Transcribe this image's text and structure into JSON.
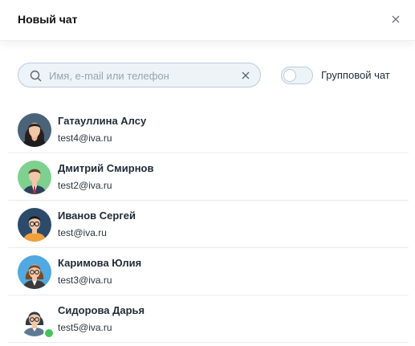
{
  "header": {
    "title": "Новый чат",
    "close_icon": "close-icon"
  },
  "search": {
    "placeholder": "Имя, e-mail или телефон",
    "value": ""
  },
  "group_toggle": {
    "label": "Групповой чат",
    "on": false
  },
  "contacts": [
    {
      "name": "Гатауллина Алсу",
      "email": "test4@iva.ru",
      "online": false,
      "avatar_bg": "#4a6378"
    },
    {
      "name": "Дмитрий Смирнов",
      "email": "test2@iva.ru",
      "online": false,
      "avatar_bg": "#7fd08f"
    },
    {
      "name": "Иванов Сергей",
      "email": "test@iva.ru",
      "online": false,
      "avatar_bg": "#2c4a6a"
    },
    {
      "name": "Каримова Юлия",
      "email": "test3@iva.ru",
      "online": false,
      "avatar_bg": "#52a8e0"
    },
    {
      "name": "Сидорова Дарья",
      "email": "test5@iva.ru",
      "online": true,
      "avatar_bg": "#ffffff"
    }
  ],
  "colors": {
    "accent": "#b9cbe0",
    "online": "#44c35a"
  }
}
